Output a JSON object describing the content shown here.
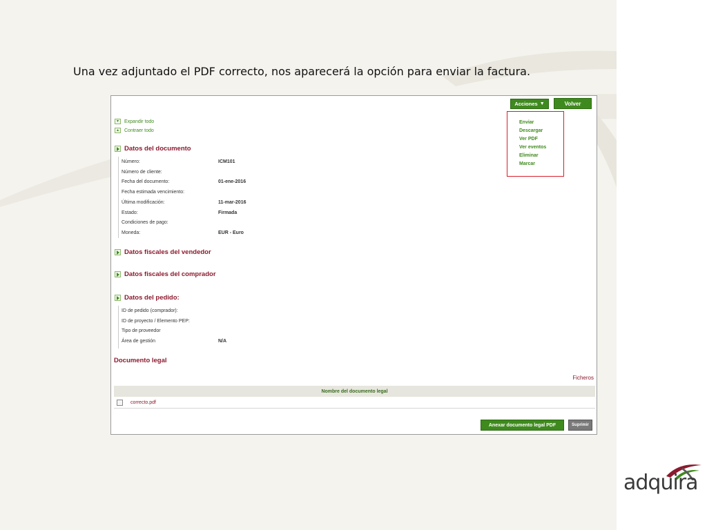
{
  "caption": "Una vez adjuntado el PDF correcto, nos aparecerá la opción para enviar la factura.",
  "toolbar": {
    "acciones_label": "Acciones",
    "volver_label": "Volver"
  },
  "actions_menu": [
    "Enviar",
    "Descargar",
    "Ver PDF",
    "Ver eventos",
    "Eliminar",
    "Marcar"
  ],
  "expand_all": "Expandir todo",
  "collapse_all": "Contraer todo",
  "sections": {
    "documento": "Datos del documento",
    "vendedor": "Datos fiscales del vendedor",
    "comprador": "Datos fiscales del comprador",
    "pedido": "Datos del pedido:"
  },
  "documento_fields": [
    {
      "label": "Número:",
      "value": "ICM101"
    },
    {
      "label": "Número de cliente:",
      "value": ""
    },
    {
      "label": "Fecha del documento:",
      "value": "01-ene-2016"
    },
    {
      "label": "Fecha estimada vencimiento:",
      "value": ""
    },
    {
      "label": "Última modificación:",
      "value": "11-mar-2016"
    },
    {
      "label": "Estado:",
      "value": "Firmada"
    },
    {
      "label": "Condiciones de pago:",
      "value": ""
    },
    {
      "label": "Moneda:",
      "value": "EUR - Euro"
    }
  ],
  "pedido_fields": [
    {
      "label": "ID de pedido (comprador):",
      "value": ""
    },
    {
      "label": "ID de proyecto / Elemento PEP:",
      "value": ""
    },
    {
      "label": "Tipo de proveedor",
      "value": ""
    },
    {
      "label": "Área de gestión",
      "value": "N/A"
    }
  ],
  "legal": {
    "title": "Documento legal",
    "ficheros": "Ficheros",
    "column_header": "Nombre del documento legal",
    "file": "correcto.pdf"
  },
  "buttons": {
    "anexar": "Anexar documento legal PDF",
    "suprimir": "Suprimir"
  },
  "logo_text": "adquira",
  "colors": {
    "accent_green": "#3f8a1e",
    "heading_maroon": "#8b1a2e",
    "highlight_red": "#d81b2a"
  }
}
